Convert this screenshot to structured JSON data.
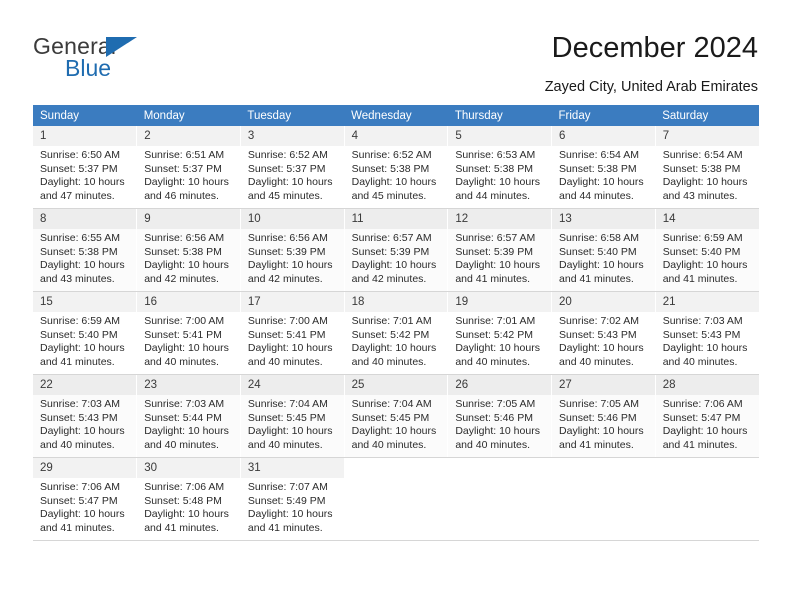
{
  "brand": {
    "name_top": "General",
    "name_bottom": "Blue",
    "accent_color": "#1f6cb0"
  },
  "header": {
    "title": "December 2024",
    "subtitle": "Zayed City, United Arab Emirates"
  },
  "calendar": {
    "header_bg": "#3b7cc0",
    "weekdays": [
      "Sunday",
      "Monday",
      "Tuesday",
      "Wednesday",
      "Thursday",
      "Friday",
      "Saturday"
    ],
    "labels": {
      "sunrise": "Sunrise:",
      "sunset": "Sunset:",
      "daylight": "Daylight:"
    },
    "weeks": [
      [
        {
          "day": "1",
          "sunrise": "Sunrise: 6:50 AM",
          "sunset": "Sunset: 5:37 PM",
          "daylight1": "Daylight: 10 hours",
          "daylight2": "and 47 minutes."
        },
        {
          "day": "2",
          "sunrise": "Sunrise: 6:51 AM",
          "sunset": "Sunset: 5:37 PM",
          "daylight1": "Daylight: 10 hours",
          "daylight2": "and 46 minutes."
        },
        {
          "day": "3",
          "sunrise": "Sunrise: 6:52 AM",
          "sunset": "Sunset: 5:37 PM",
          "daylight1": "Daylight: 10 hours",
          "daylight2": "and 45 minutes."
        },
        {
          "day": "4",
          "sunrise": "Sunrise: 6:52 AM",
          "sunset": "Sunset: 5:38 PM",
          "daylight1": "Daylight: 10 hours",
          "daylight2": "and 45 minutes."
        },
        {
          "day": "5",
          "sunrise": "Sunrise: 6:53 AM",
          "sunset": "Sunset: 5:38 PM",
          "daylight1": "Daylight: 10 hours",
          "daylight2": "and 44 minutes."
        },
        {
          "day": "6",
          "sunrise": "Sunrise: 6:54 AM",
          "sunset": "Sunset: 5:38 PM",
          "daylight1": "Daylight: 10 hours",
          "daylight2": "and 44 minutes."
        },
        {
          "day": "7",
          "sunrise": "Sunrise: 6:54 AM",
          "sunset": "Sunset: 5:38 PM",
          "daylight1": "Daylight: 10 hours",
          "daylight2": "and 43 minutes."
        }
      ],
      [
        {
          "day": "8",
          "sunrise": "Sunrise: 6:55 AM",
          "sunset": "Sunset: 5:38 PM",
          "daylight1": "Daylight: 10 hours",
          "daylight2": "and 43 minutes."
        },
        {
          "day": "9",
          "sunrise": "Sunrise: 6:56 AM",
          "sunset": "Sunset: 5:38 PM",
          "daylight1": "Daylight: 10 hours",
          "daylight2": "and 42 minutes."
        },
        {
          "day": "10",
          "sunrise": "Sunrise: 6:56 AM",
          "sunset": "Sunset: 5:39 PM",
          "daylight1": "Daylight: 10 hours",
          "daylight2": "and 42 minutes."
        },
        {
          "day": "11",
          "sunrise": "Sunrise: 6:57 AM",
          "sunset": "Sunset: 5:39 PM",
          "daylight1": "Daylight: 10 hours",
          "daylight2": "and 42 minutes."
        },
        {
          "day": "12",
          "sunrise": "Sunrise: 6:57 AM",
          "sunset": "Sunset: 5:39 PM",
          "daylight1": "Daylight: 10 hours",
          "daylight2": "and 41 minutes."
        },
        {
          "day": "13",
          "sunrise": "Sunrise: 6:58 AM",
          "sunset": "Sunset: 5:40 PM",
          "daylight1": "Daylight: 10 hours",
          "daylight2": "and 41 minutes."
        },
        {
          "day": "14",
          "sunrise": "Sunrise: 6:59 AM",
          "sunset": "Sunset: 5:40 PM",
          "daylight1": "Daylight: 10 hours",
          "daylight2": "and 41 minutes."
        }
      ],
      [
        {
          "day": "15",
          "sunrise": "Sunrise: 6:59 AM",
          "sunset": "Sunset: 5:40 PM",
          "daylight1": "Daylight: 10 hours",
          "daylight2": "and 41 minutes."
        },
        {
          "day": "16",
          "sunrise": "Sunrise: 7:00 AM",
          "sunset": "Sunset: 5:41 PM",
          "daylight1": "Daylight: 10 hours",
          "daylight2": "and 40 minutes."
        },
        {
          "day": "17",
          "sunrise": "Sunrise: 7:00 AM",
          "sunset": "Sunset: 5:41 PM",
          "daylight1": "Daylight: 10 hours",
          "daylight2": "and 40 minutes."
        },
        {
          "day": "18",
          "sunrise": "Sunrise: 7:01 AM",
          "sunset": "Sunset: 5:42 PM",
          "daylight1": "Daylight: 10 hours",
          "daylight2": "and 40 minutes."
        },
        {
          "day": "19",
          "sunrise": "Sunrise: 7:01 AM",
          "sunset": "Sunset: 5:42 PM",
          "daylight1": "Daylight: 10 hours",
          "daylight2": "and 40 minutes."
        },
        {
          "day": "20",
          "sunrise": "Sunrise: 7:02 AM",
          "sunset": "Sunset: 5:43 PM",
          "daylight1": "Daylight: 10 hours",
          "daylight2": "and 40 minutes."
        },
        {
          "day": "21",
          "sunrise": "Sunrise: 7:03 AM",
          "sunset": "Sunset: 5:43 PM",
          "daylight1": "Daylight: 10 hours",
          "daylight2": "and 40 minutes."
        }
      ],
      [
        {
          "day": "22",
          "sunrise": "Sunrise: 7:03 AM",
          "sunset": "Sunset: 5:43 PM",
          "daylight1": "Daylight: 10 hours",
          "daylight2": "and 40 minutes."
        },
        {
          "day": "23",
          "sunrise": "Sunrise: 7:03 AM",
          "sunset": "Sunset: 5:44 PM",
          "daylight1": "Daylight: 10 hours",
          "daylight2": "and 40 minutes."
        },
        {
          "day": "24",
          "sunrise": "Sunrise: 7:04 AM",
          "sunset": "Sunset: 5:45 PM",
          "daylight1": "Daylight: 10 hours",
          "daylight2": "and 40 minutes."
        },
        {
          "day": "25",
          "sunrise": "Sunrise: 7:04 AM",
          "sunset": "Sunset: 5:45 PM",
          "daylight1": "Daylight: 10 hours",
          "daylight2": "and 40 minutes."
        },
        {
          "day": "26",
          "sunrise": "Sunrise: 7:05 AM",
          "sunset": "Sunset: 5:46 PM",
          "daylight1": "Daylight: 10 hours",
          "daylight2": "and 40 minutes."
        },
        {
          "day": "27",
          "sunrise": "Sunrise: 7:05 AM",
          "sunset": "Sunset: 5:46 PM",
          "daylight1": "Daylight: 10 hours",
          "daylight2": "and 41 minutes."
        },
        {
          "day": "28",
          "sunrise": "Sunrise: 7:06 AM",
          "sunset": "Sunset: 5:47 PM",
          "daylight1": "Daylight: 10 hours",
          "daylight2": "and 41 minutes."
        }
      ],
      [
        {
          "day": "29",
          "sunrise": "Sunrise: 7:06 AM",
          "sunset": "Sunset: 5:47 PM",
          "daylight1": "Daylight: 10 hours",
          "daylight2": "and 41 minutes."
        },
        {
          "day": "30",
          "sunrise": "Sunrise: 7:06 AM",
          "sunset": "Sunset: 5:48 PM",
          "daylight1": "Daylight: 10 hours",
          "daylight2": "and 41 minutes."
        },
        {
          "day": "31",
          "sunrise": "Sunrise: 7:07 AM",
          "sunset": "Sunset: 5:49 PM",
          "daylight1": "Daylight: 10 hours",
          "daylight2": "and 41 minutes."
        },
        {
          "day": "",
          "sunrise": "",
          "sunset": "",
          "daylight1": "",
          "daylight2": ""
        },
        {
          "day": "",
          "sunrise": "",
          "sunset": "",
          "daylight1": "",
          "daylight2": ""
        },
        {
          "day": "",
          "sunrise": "",
          "sunset": "",
          "daylight1": "",
          "daylight2": ""
        },
        {
          "day": "",
          "sunrise": "",
          "sunset": "",
          "daylight1": "",
          "daylight2": ""
        }
      ]
    ]
  }
}
